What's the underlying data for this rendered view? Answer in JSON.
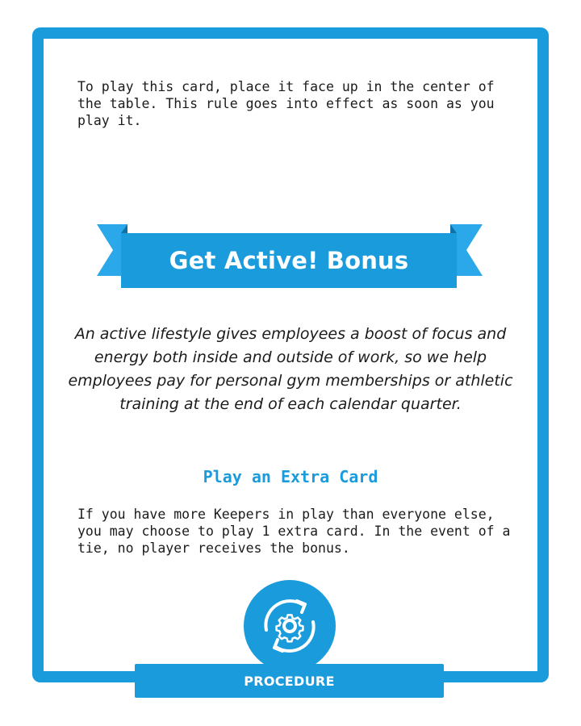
{
  "card": {
    "intro": "To play this card, place it face up in the center of the table. This rule goes into effect as soon as you play it.",
    "title": "Get Active! Bonus",
    "description": "An active lifestyle gives employees a boost of focus and energy both inside and outside of work, so we help employees pay for personal gym memberships or athletic training at the end of each calendar quarter.",
    "bonus_heading": "Play an Extra Card",
    "bonus_text": "If you have more Keepers in play than everyone else, you may choose to play 1 extra card. In the event of a tie, no player receives the bonus.",
    "type_label": "PROCEDURE",
    "type_icon": "gear-cycle-icon"
  },
  "colors": {
    "accent": "#1a9bdc",
    "ribbon_light": "#2aa8ea",
    "ribbon_dark": "#0f73a8",
    "text": "#1b1b1b",
    "background": "#ffffff"
  }
}
